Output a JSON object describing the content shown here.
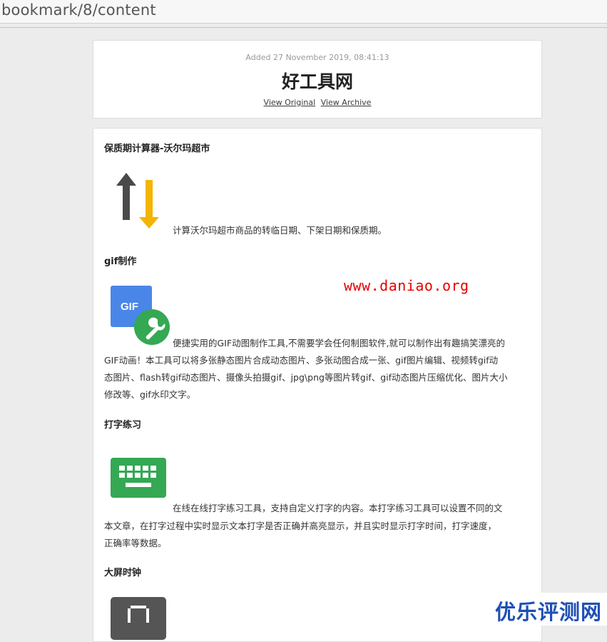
{
  "browser": {
    "url": "bookmark/8/content"
  },
  "header": {
    "added": "Added 27 November 2019, 08:41:13",
    "title": "好工具网",
    "view_original": "View Original",
    "view_archive": "View Archive"
  },
  "sections": [
    {
      "title": "保质期计算器-沃尔玛超市",
      "desc": "计算沃尔玛超市商品的转临日期、下架日期和保质期。"
    },
    {
      "title": "gif制作",
      "desc_lines": [
        "便捷实用的GIF动图制作工具,不需要学会任何制图软件,就可以制作出有趣搞笑漂亮的",
        "GIF动画！本工具可以将多张静态图片合成动态图片、多张动图合成一张、gif图片编辑、视频转gif动",
        "态图片、flash转gif动态图片、摄像头拍摄gif、jpg\\png等图片转gif、gif动态图片压缩优化、图片大小",
        "修改等、gif水印文字。"
      ],
      "icon_text": "GIF"
    },
    {
      "title": "打字练习",
      "desc_lines": [
        "在线在线打字练习工具，支持自定义打字的内容。本打字练习工具可以设置不同的文",
        "本文章，在打字过程中实时显示文本打字是否正确并高亮显示，并且实时显示打字时间，打字速度，",
        "正确率等数据。"
      ]
    },
    {
      "title": "大屏时钟"
    }
  ],
  "watermark": "www.daniao.org",
  "corner_watermark": "优乐评测网",
  "colors": {
    "arrow_up": "#4a4a4a",
    "arrow_down": "#f5b400",
    "gif_blue": "#4a86e8",
    "wrench_green": "#34a853",
    "keyboard_green": "#34a853",
    "clock_gray": "#555555"
  }
}
